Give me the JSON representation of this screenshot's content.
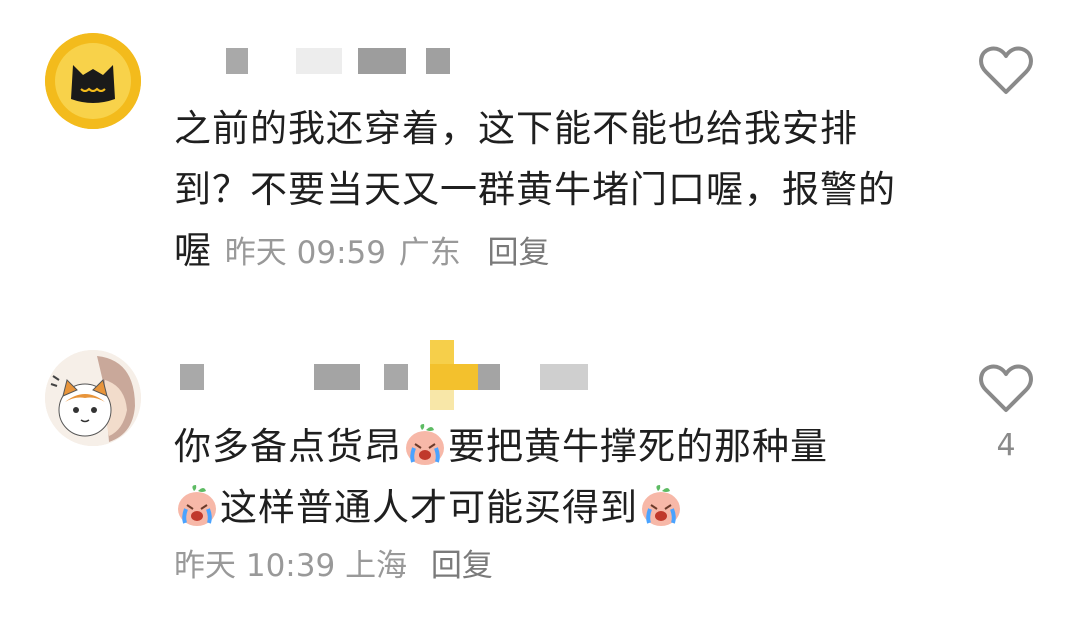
{
  "comments": [
    {
      "avatar": "black-cat-avatar",
      "text": "之前的我还穿着，这下能不能也给我安排到？不要当天又一群黄牛堵门口喔，报警的喔",
      "time": "昨天 09:59",
      "location": "广东",
      "reply_label": "回复",
      "likes": ""
    },
    {
      "avatar": "cat-and-girl-avatar",
      "text_part1": "你多备点货昂",
      "text_part2": "要把黄牛撑死的那种量",
      "text_part3": "这样普通人才可能买得到",
      "emoji": "crying-peach-emoji",
      "time": "昨天 10:39",
      "location": "上海",
      "reply_label": "回复",
      "likes": "4"
    }
  ],
  "colors": {
    "text": "#1f1f1f",
    "meta": "#999999",
    "icon": "#8a8a8a",
    "avatar1_ring": "#f3bb1c"
  },
  "icons": [
    "heart-outline-icon"
  ]
}
